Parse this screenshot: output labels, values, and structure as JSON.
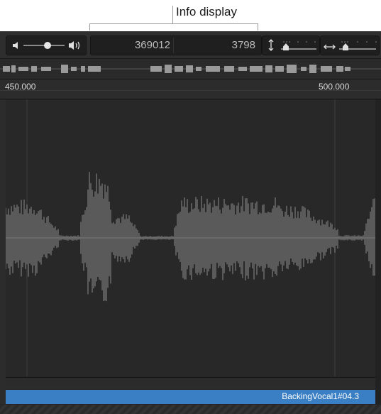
{
  "callout": {
    "label": "Info display"
  },
  "toolbar": {
    "volume": {
      "level": 0.65,
      "low_icon": "speaker-low-icon",
      "high_icon": "speaker-high-icon"
    },
    "info": {
      "left_value": "369012",
      "right_value": "3798"
    },
    "vertical_zoom": {
      "icon": "vertical-arrows-icon",
      "level": 0.3
    },
    "horizontal_zoom": {
      "icon": "horizontal-arrows-icon",
      "level": 0.3
    }
  },
  "ruler": {
    "marks": [
      "450.000",
      "500.000"
    ]
  },
  "region": {
    "name": "BackingVocal1#04.3",
    "color": "#3a7fc4"
  }
}
